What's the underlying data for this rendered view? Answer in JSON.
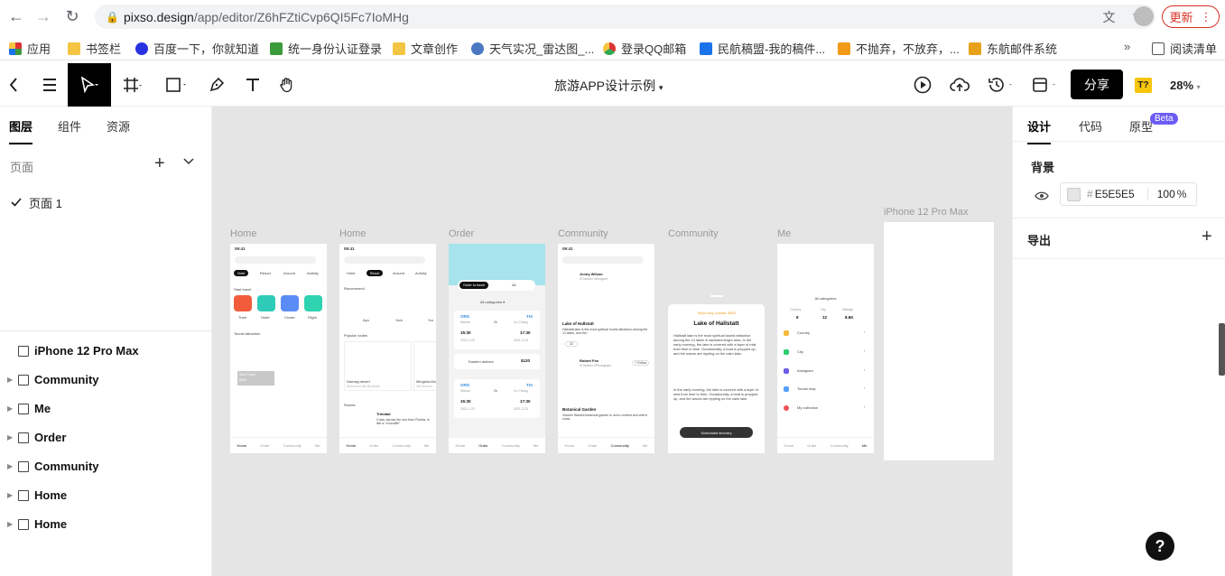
{
  "browser": {
    "url_host": "pixso.design",
    "url_path": "/app/editor/Z6hFZtiCvp6QI5Fc7IoMHg",
    "update_label": "更新",
    "bookmarks": [
      {
        "label": "应用",
        "color": "#d33"
      },
      {
        "label": "书签栏",
        "color": "#f4c542"
      },
      {
        "label": "百度一下，你就知道",
        "color": "#2932e1"
      },
      {
        "label": "统一身份认证登录",
        "color": "#3b9b3b"
      },
      {
        "label": "文章创作",
        "color": "#f4c542"
      },
      {
        "label": "天气实况_雷达图_...",
        "color": "#4a78c2"
      },
      {
        "label": "登录QQ邮箱",
        "color": "#34a853"
      },
      {
        "label": "民航稿盟-我的稿件...",
        "color": "#1a73e8"
      },
      {
        "label": "不抛弃，不放弃，...",
        "color": "#f29b19"
      },
      {
        "label": "东航邮件系统",
        "color": "#e8a219"
      },
      {
        "label": "阅读清单",
        "color": "#555"
      }
    ]
  },
  "toolbar": {
    "doc_title": "旅游APP设计示例",
    "share_label": "分享",
    "avatar": "T?",
    "zoom": "28%"
  },
  "left_panel": {
    "tabs": [
      "图层",
      "组件",
      "资源"
    ],
    "pages_header": "页面",
    "page_item": "页面 1",
    "layers": [
      "iPhone 12 Pro Max",
      "Community",
      "Me",
      "Order",
      "Community",
      "Home",
      "Home"
    ]
  },
  "canvas": {
    "frames": [
      "Home",
      "Home",
      "Order",
      "Community",
      "Community",
      "Me",
      "iPhone 12 Pro Max"
    ],
    "home1": {
      "time": "09:41",
      "chips": [
        "Hotel",
        "Resort",
        "Around",
        "Activity"
      ],
      "start_travel": "Start travel",
      "icons": [
        "Train",
        "Hotel",
        "Cruise",
        "Flight"
      ],
      "tourist": "Tourist attraction",
      "card_title": "Start Travel",
      "card_price": "$300",
      "tabs": [
        "Home",
        "Order",
        "Community",
        "Me"
      ]
    },
    "home2": {
      "time": "09:41",
      "chips": [
        "Hotel",
        "Resort",
        "Around",
        "Activity"
      ],
      "recommend": "Recommend",
      "cities": [
        "Ayo",
        "York",
        "Yur"
      ],
      "popular": "Popular routes",
      "route1": "Namsig desert",
      "route1_sub": "30 km from the city center",
      "route2": "Mingsha Mo",
      "route2_sub": "100 km from",
      "routes": "Routes",
      "trip_title": "Trinidad",
      "trip_desc": "Cuba, across the sea from Florida, is like a \"crocodile\"",
      "tabs": [
        "Home",
        "Order",
        "Community",
        "Me"
      ]
    },
    "order": {
      "tab_active": "Order to travel",
      "tab_all": "All",
      "categories": "All categories ▾",
      "from": "ORD",
      "to": "TIA",
      "from_city": "Wuhan",
      "to_city": "Xu Chang",
      "duration": "2h",
      "depart": "15:30",
      "arrive": "17:30",
      "date": "2021-2-23",
      "airline": "Eastern airlines",
      "price": "$120",
      "tabs": [
        "Home",
        "Order",
        "Community",
        "Me"
      ]
    },
    "community1": {
      "time": "09:41",
      "user1": "Jenny Wilson",
      "user1_tags": "#Traveller  #Designer",
      "post_title": "Lake of Hallstatt",
      "post_body": "Hallstatt lake is the most spiritual tourist attraction among the 14 lakes, and the...",
      "likes": "32",
      "user2": "Robert Fox",
      "user2_tags": "#Traveller  #Photograph",
      "follow": "+ Follow",
      "post2_title": "Botanical Garden",
      "post2_body": "Xiamen Wanshi botanical garden is not in content and visit in snow.",
      "tabs": [
        "Home",
        "Order",
        "Community",
        "Me"
      ]
    },
    "community2": {
      "meta": "Tokyo long, Austria, $300",
      "title": "Lake of Hallstatt",
      "p1": "Hallstatt lake is the most spiritual tourist attraction among the 14 lakes in salzkammergut area. In the early morning, the lake is covered with a layer of mist from time to time. Occasionally, a boat is propped up, and the waves are rippling on the calm lake.",
      "p2": "In the early morning, the lake is covered with a layer of mist from time to time. Occasionally, a boat is propped up, and the waves are rippling on the calm lake.",
      "button": "Scheduled itinerary"
    },
    "me": {
      "categories": "All categories",
      "stats": [
        {
          "label": "Country",
          "value": "8"
        },
        {
          "label": "City",
          "value": "12"
        },
        {
          "label": "Mileage",
          "value": "8.6K"
        }
      ],
      "menu": [
        {
          "label": "Country",
          "color": "#f6b93b"
        },
        {
          "label": "City",
          "color": "#2ecc71"
        },
        {
          "label": "Instagram",
          "color": "#6c5ce7"
        },
        {
          "label": "Tourist map",
          "color": "#54a0ff"
        },
        {
          "label": "My collection",
          "color": "#ee5253"
        }
      ],
      "tabs": [
        "Home",
        "Order",
        "Community",
        "Me"
      ]
    }
  },
  "right_panel": {
    "tabs": [
      "设计",
      "代码",
      "原型"
    ],
    "beta": "Beta",
    "background_header": "背景",
    "bg_hash": "#",
    "bg_color": "E5E5E5",
    "bg_opacity": "100",
    "bg_percent": "%",
    "export_header": "导出"
  },
  "help_label": "?"
}
